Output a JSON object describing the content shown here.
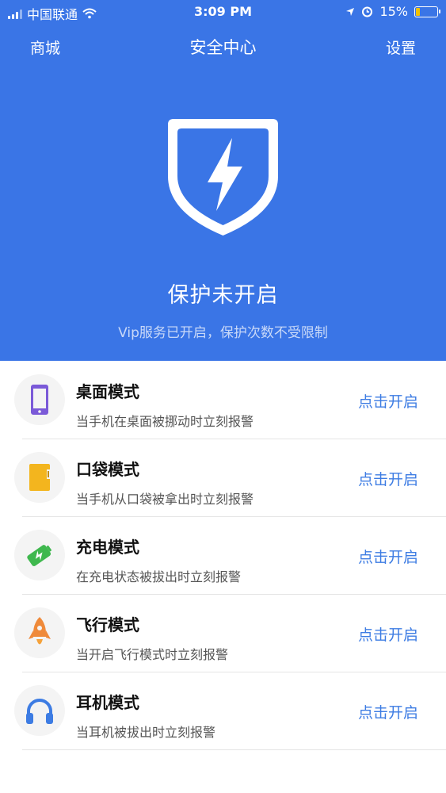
{
  "status_bar": {
    "carrier": "中国联通",
    "time": "3:09 PM",
    "battery_percent": "15%"
  },
  "nav": {
    "left": "商城",
    "title": "安全中心",
    "right": "设置"
  },
  "hero": {
    "status": "保护未开启",
    "subtitle": "Vip服务已开启，保护次数不受限制",
    "colors": {
      "background": "#3a75e6"
    }
  },
  "modes": [
    {
      "title": "桌面模式",
      "desc": "当手机在桌面被挪动时立刻报警",
      "action": "点击开启",
      "icon": "phone-icon"
    },
    {
      "title": "口袋模式",
      "desc": "当手机从口袋被拿出时立刻报警",
      "action": "点击开启",
      "icon": "pocket-icon"
    },
    {
      "title": "充电模式",
      "desc": "在充电状态被拔出时立刻报警",
      "action": "点击开启",
      "icon": "battery-charge-icon"
    },
    {
      "title": "飞行模式",
      "desc": "当开启飞行模式时立刻报警",
      "action": "点击开启",
      "icon": "rocket-icon"
    },
    {
      "title": "耳机模式",
      "desc": "当耳机被拔出时立刻报警",
      "action": "点击开启",
      "icon": "headphones-icon"
    }
  ],
  "accent_color": "#3d7ce3"
}
